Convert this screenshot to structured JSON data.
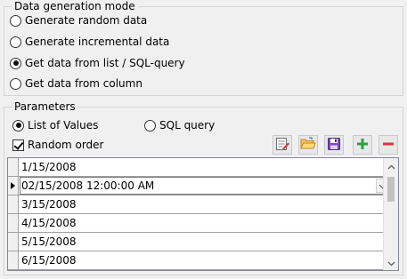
{
  "mode_group": {
    "title": "Data generation mode",
    "options": [
      {
        "label": "Generate random data",
        "checked": false
      },
      {
        "label": "Generate incremental data",
        "checked": false
      },
      {
        "label": "Get data from list / SQL-query",
        "checked": true
      },
      {
        "label": "Get data from column",
        "checked": false
      }
    ]
  },
  "params_group": {
    "title": "Parameters",
    "source_options": [
      {
        "label": "List of Values",
        "checked": true
      },
      {
        "label": "SQL query",
        "checked": false
      }
    ],
    "random_order": {
      "label": "Random order",
      "checked": true
    },
    "toolbar_icons": [
      "edit-list-icon",
      "open-folder-icon",
      "save-disk-icon",
      "add-plus-icon",
      "remove-minus-icon"
    ]
  },
  "grid": {
    "rows": [
      {
        "value": "1/15/2008",
        "current": false,
        "editing": false
      },
      {
        "value": "02/15/2008 12:00:00 AM",
        "current": true,
        "editing": true
      },
      {
        "value": "3/15/2008",
        "current": false,
        "editing": false
      },
      {
        "value": "4/15/2008",
        "current": false,
        "editing": false
      },
      {
        "value": "5/15/2008",
        "current": false,
        "editing": false
      },
      {
        "value": "6/15/2008",
        "current": false,
        "editing": false
      }
    ]
  },
  "colors": {
    "group_border": "#d5d5d5",
    "background": "#f0f0f0",
    "grid_line": "#a0a0a0",
    "plus_green": "#2e9e3e",
    "minus_red": "#d9363e",
    "save_purple": "#6a3aa8",
    "folder_yellow": "#e8b74a"
  }
}
